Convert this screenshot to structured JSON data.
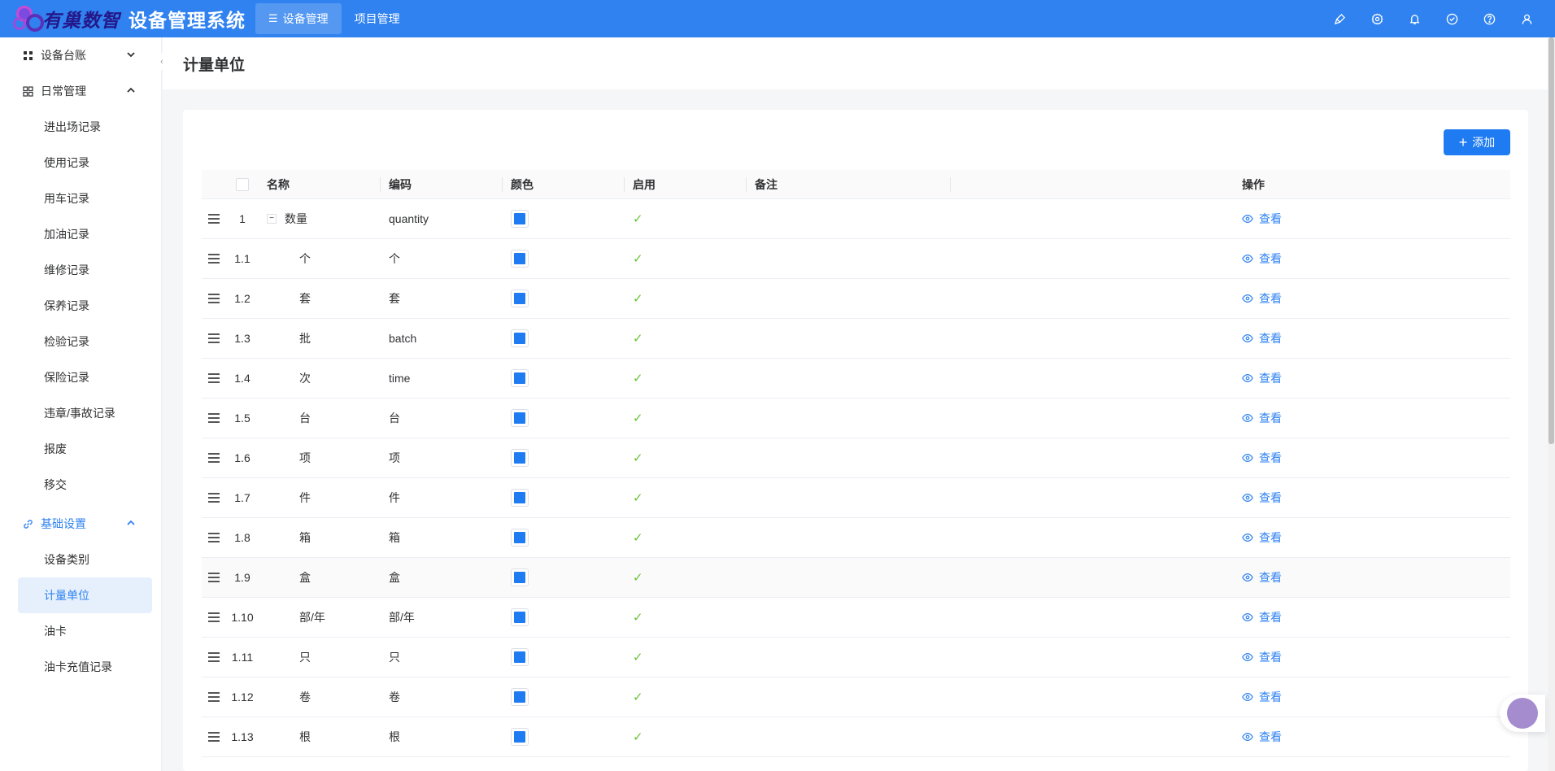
{
  "header": {
    "logo_text": "有巢数智",
    "system_title": "设备管理系统",
    "nav": [
      {
        "label": "设备管理",
        "icon": "list-icon",
        "active": true
      },
      {
        "label": "项目管理",
        "active": false
      }
    ],
    "icons": [
      "brush-icon",
      "settings-icon",
      "bell-icon",
      "check-circle-icon",
      "help-icon",
      "user-icon"
    ]
  },
  "sidebar": {
    "groups": [
      {
        "label": "设备台账",
        "icon": "grid-icon",
        "expanded": false,
        "items": []
      },
      {
        "label": "日常管理",
        "icon": "layout-icon",
        "expanded": true,
        "items": [
          "进出场记录",
          "使用记录",
          "用车记录",
          "加油记录",
          "维修记录",
          "保养记录",
          "检验记录",
          "保险记录",
          "违章/事故记录",
          "报废",
          "移交"
        ]
      },
      {
        "label": "基础设置",
        "icon": "link-icon",
        "expanded": true,
        "active": true,
        "items": [
          "设备类别",
          "计量单位",
          "油卡",
          "油卡充值记录"
        ]
      }
    ],
    "active_item": "计量单位"
  },
  "page": {
    "title": "计量单位",
    "add_button": "添加"
  },
  "table": {
    "columns": {
      "name": "名称",
      "code": "编码",
      "color": "颜色",
      "enabled": "启用",
      "remark": "备注",
      "actions": "操作"
    },
    "view_label": "查看",
    "enabled_color": "#67c23a",
    "color_swatch": "#1f7bf1",
    "rows": [
      {
        "index": "1",
        "name": "数量",
        "code": "quantity",
        "enabled": true,
        "parent": true
      },
      {
        "index": "1.1",
        "name": "个",
        "code": "个",
        "enabled": true
      },
      {
        "index": "1.2",
        "name": "套",
        "code": "套",
        "enabled": true
      },
      {
        "index": "1.3",
        "name": "批",
        "code": "batch",
        "enabled": true
      },
      {
        "index": "1.4",
        "name": "次",
        "code": "time",
        "enabled": true
      },
      {
        "index": "1.5",
        "name": "台",
        "code": "台",
        "enabled": true
      },
      {
        "index": "1.6",
        "name": "项",
        "code": "项",
        "enabled": true
      },
      {
        "index": "1.7",
        "name": "件",
        "code": "件",
        "enabled": true
      },
      {
        "index": "1.8",
        "name": "箱",
        "code": "箱",
        "enabled": true
      },
      {
        "index": "1.9",
        "name": "盒",
        "code": "盒",
        "enabled": true
      },
      {
        "index": "1.10",
        "name": "部/年",
        "code": "部/年",
        "enabled": true
      },
      {
        "index": "1.11",
        "name": "只",
        "code": "只",
        "enabled": true
      },
      {
        "index": "1.12",
        "name": "卷",
        "code": "卷",
        "enabled": true
      },
      {
        "index": "1.13",
        "name": "根",
        "code": "根",
        "enabled": true
      }
    ]
  }
}
